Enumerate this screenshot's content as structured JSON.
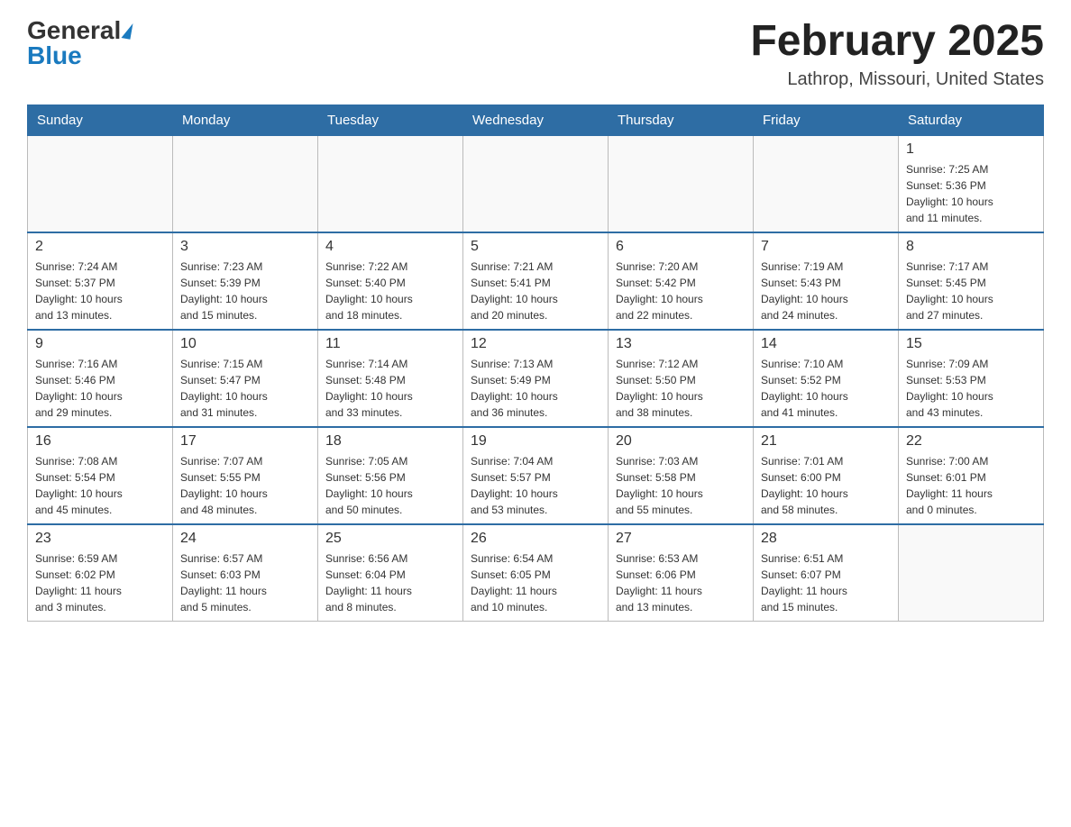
{
  "logo": {
    "general": "General",
    "blue": "Blue"
  },
  "title": "February 2025",
  "subtitle": "Lathrop, Missouri, United States",
  "weekdays": [
    "Sunday",
    "Monday",
    "Tuesday",
    "Wednesday",
    "Thursday",
    "Friday",
    "Saturday"
  ],
  "weeks": [
    [
      {
        "day": "",
        "info": ""
      },
      {
        "day": "",
        "info": ""
      },
      {
        "day": "",
        "info": ""
      },
      {
        "day": "",
        "info": ""
      },
      {
        "day": "",
        "info": ""
      },
      {
        "day": "",
        "info": ""
      },
      {
        "day": "1",
        "info": "Sunrise: 7:25 AM\nSunset: 5:36 PM\nDaylight: 10 hours\nand 11 minutes."
      }
    ],
    [
      {
        "day": "2",
        "info": "Sunrise: 7:24 AM\nSunset: 5:37 PM\nDaylight: 10 hours\nand 13 minutes."
      },
      {
        "day": "3",
        "info": "Sunrise: 7:23 AM\nSunset: 5:39 PM\nDaylight: 10 hours\nand 15 minutes."
      },
      {
        "day": "4",
        "info": "Sunrise: 7:22 AM\nSunset: 5:40 PM\nDaylight: 10 hours\nand 18 minutes."
      },
      {
        "day": "5",
        "info": "Sunrise: 7:21 AM\nSunset: 5:41 PM\nDaylight: 10 hours\nand 20 minutes."
      },
      {
        "day": "6",
        "info": "Sunrise: 7:20 AM\nSunset: 5:42 PM\nDaylight: 10 hours\nand 22 minutes."
      },
      {
        "day": "7",
        "info": "Sunrise: 7:19 AM\nSunset: 5:43 PM\nDaylight: 10 hours\nand 24 minutes."
      },
      {
        "day": "8",
        "info": "Sunrise: 7:17 AM\nSunset: 5:45 PM\nDaylight: 10 hours\nand 27 minutes."
      }
    ],
    [
      {
        "day": "9",
        "info": "Sunrise: 7:16 AM\nSunset: 5:46 PM\nDaylight: 10 hours\nand 29 minutes."
      },
      {
        "day": "10",
        "info": "Sunrise: 7:15 AM\nSunset: 5:47 PM\nDaylight: 10 hours\nand 31 minutes."
      },
      {
        "day": "11",
        "info": "Sunrise: 7:14 AM\nSunset: 5:48 PM\nDaylight: 10 hours\nand 33 minutes."
      },
      {
        "day": "12",
        "info": "Sunrise: 7:13 AM\nSunset: 5:49 PM\nDaylight: 10 hours\nand 36 minutes."
      },
      {
        "day": "13",
        "info": "Sunrise: 7:12 AM\nSunset: 5:50 PM\nDaylight: 10 hours\nand 38 minutes."
      },
      {
        "day": "14",
        "info": "Sunrise: 7:10 AM\nSunset: 5:52 PM\nDaylight: 10 hours\nand 41 minutes."
      },
      {
        "day": "15",
        "info": "Sunrise: 7:09 AM\nSunset: 5:53 PM\nDaylight: 10 hours\nand 43 minutes."
      }
    ],
    [
      {
        "day": "16",
        "info": "Sunrise: 7:08 AM\nSunset: 5:54 PM\nDaylight: 10 hours\nand 45 minutes."
      },
      {
        "day": "17",
        "info": "Sunrise: 7:07 AM\nSunset: 5:55 PM\nDaylight: 10 hours\nand 48 minutes."
      },
      {
        "day": "18",
        "info": "Sunrise: 7:05 AM\nSunset: 5:56 PM\nDaylight: 10 hours\nand 50 minutes."
      },
      {
        "day": "19",
        "info": "Sunrise: 7:04 AM\nSunset: 5:57 PM\nDaylight: 10 hours\nand 53 minutes."
      },
      {
        "day": "20",
        "info": "Sunrise: 7:03 AM\nSunset: 5:58 PM\nDaylight: 10 hours\nand 55 minutes."
      },
      {
        "day": "21",
        "info": "Sunrise: 7:01 AM\nSunset: 6:00 PM\nDaylight: 10 hours\nand 58 minutes."
      },
      {
        "day": "22",
        "info": "Sunrise: 7:00 AM\nSunset: 6:01 PM\nDaylight: 11 hours\nand 0 minutes."
      }
    ],
    [
      {
        "day": "23",
        "info": "Sunrise: 6:59 AM\nSunset: 6:02 PM\nDaylight: 11 hours\nand 3 minutes."
      },
      {
        "day": "24",
        "info": "Sunrise: 6:57 AM\nSunset: 6:03 PM\nDaylight: 11 hours\nand 5 minutes."
      },
      {
        "day": "25",
        "info": "Sunrise: 6:56 AM\nSunset: 6:04 PM\nDaylight: 11 hours\nand 8 minutes."
      },
      {
        "day": "26",
        "info": "Sunrise: 6:54 AM\nSunset: 6:05 PM\nDaylight: 11 hours\nand 10 minutes."
      },
      {
        "day": "27",
        "info": "Sunrise: 6:53 AM\nSunset: 6:06 PM\nDaylight: 11 hours\nand 13 minutes."
      },
      {
        "day": "28",
        "info": "Sunrise: 6:51 AM\nSunset: 6:07 PM\nDaylight: 11 hours\nand 15 minutes."
      },
      {
        "day": "",
        "info": ""
      }
    ]
  ]
}
